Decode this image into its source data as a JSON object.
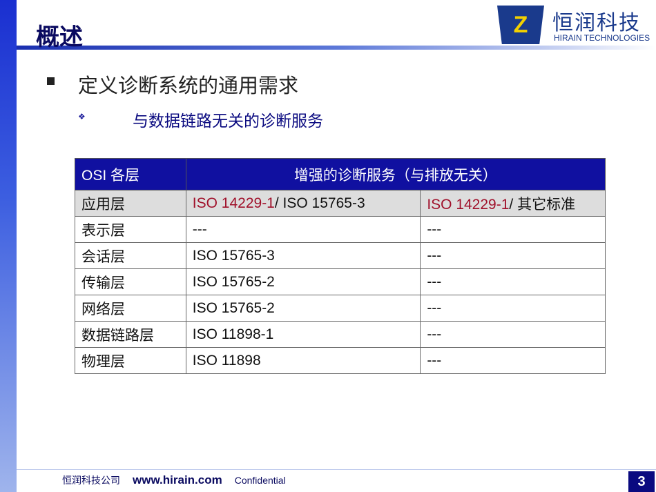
{
  "slide": {
    "title": "概述",
    "page_number": "3"
  },
  "logo": {
    "name_cn": "恒润科技",
    "name_en": "HIRAIN TECHNOLOGIES",
    "brand_color": "#1a3a8c",
    "accent": "#f2d000"
  },
  "bullets": {
    "level1": "定义诊断系统的通用需求",
    "level2": "与数据链路无关的诊断服务"
  },
  "table": {
    "headers": [
      "OSI 各层",
      "增强的诊断服务（与排放无关）"
    ],
    "rows": [
      {
        "layer": "应用层",
        "c1_red": "ISO 14229-1",
        "c1_rest": "/ ISO 15765-3",
        "c2_red": "ISO 14229-1",
        "c2_rest": "/ 其它标准"
      },
      {
        "layer": "表示层",
        "c1_red": "",
        "c1_rest": "---",
        "c2_red": "",
        "c2_rest": "---"
      },
      {
        "layer": "会话层",
        "c1_red": "",
        "c1_rest": "ISO 15765-3",
        "c2_red": "",
        "c2_rest": "---"
      },
      {
        "layer": "传输层",
        "c1_red": "",
        "c1_rest": "ISO 15765-2",
        "c2_red": "",
        "c2_rest": "---"
      },
      {
        "layer": "网络层",
        "c1_red": "",
        "c1_rest": "ISO 15765-2",
        "c2_red": "",
        "c2_rest": "---"
      },
      {
        "layer": "数据链路层",
        "c1_red": "",
        "c1_rest": "ISO 11898-1",
        "c2_red": "",
        "c2_rest": "---"
      },
      {
        "layer": "物理层",
        "c1_red": "",
        "c1_rest": "ISO 11898",
        "c2_red": "",
        "c2_rest": "---"
      }
    ]
  },
  "footer": {
    "company": "恒润科技公司",
    "url": "www.hirain.com",
    "confidential": "Confidential"
  }
}
